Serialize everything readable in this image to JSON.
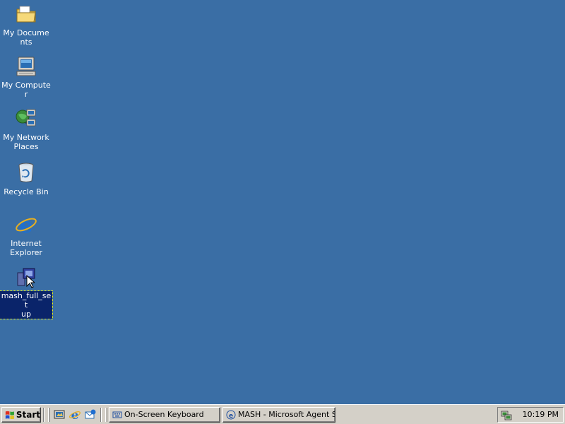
{
  "desktop": {
    "background_color": "#3a6ea5",
    "icons": [
      {
        "label": "My Documents",
        "icon": "folder-icon"
      },
      {
        "label": "My Computer",
        "icon": "computer-icon"
      },
      {
        "label": "My Network\nPlaces",
        "icon": "network-icon"
      },
      {
        "label": "Recycle Bin",
        "icon": "recycle-bin-icon"
      },
      {
        "label": "Internet\nExplorer",
        "icon": "internet-explorer-icon"
      },
      {
        "label": "mash_full_set\nup",
        "icon": "installer-icon",
        "selected": true
      }
    ]
  },
  "taskbar": {
    "start_label": "Start",
    "quick_launch": [
      "show-desktop-icon",
      "internet-explorer-icon",
      "outlook-express-icon"
    ],
    "tasks": [
      {
        "label": "On-Screen Keyboard",
        "icon": "keyboard-icon"
      },
      {
        "label": "MASH - Microsoft Agent S...",
        "icon": "mash-icon"
      }
    ],
    "tray": {
      "clock": "10:19 PM",
      "icons": [
        "network-tray-icon"
      ]
    }
  }
}
